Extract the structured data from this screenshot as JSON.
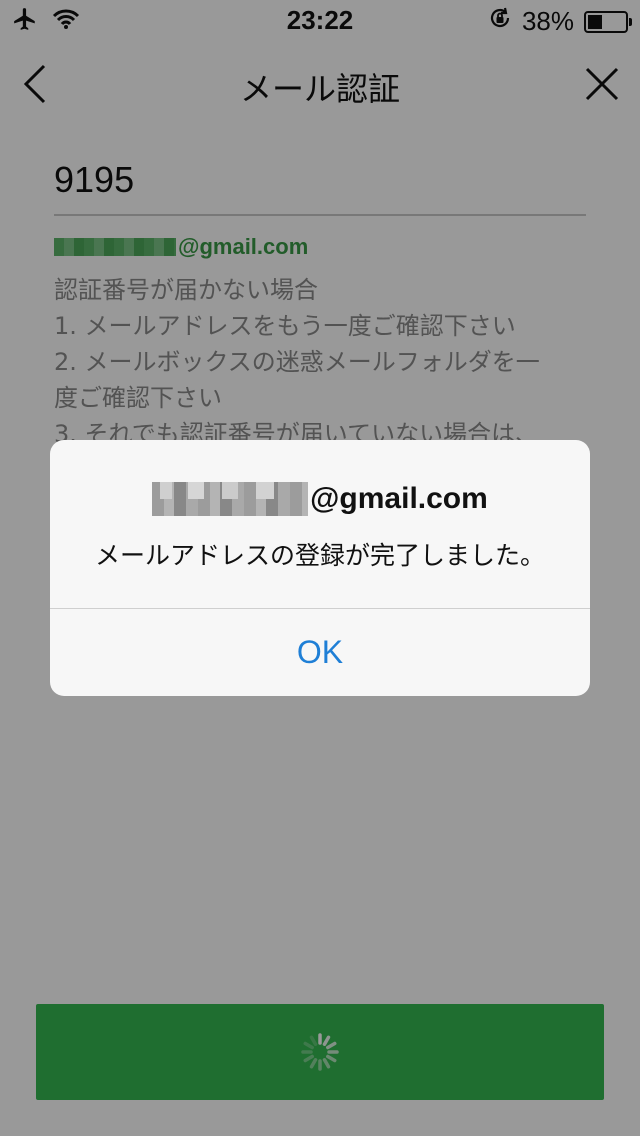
{
  "status_bar": {
    "time": "23:22",
    "battery_percent": "38%",
    "battery_level": 0.38,
    "icons": [
      "airplane-icon",
      "wifi-icon",
      "rotation-lock-icon",
      "battery-icon"
    ]
  },
  "nav": {
    "title": "メール認証",
    "back_icon": "chevron-left-icon",
    "close_icon": "close-icon"
  },
  "form": {
    "code_value": "9195",
    "email_domain": "@gmail.com",
    "help_lines": [
      "認証番号が届かない場合",
      "1. メールアドレスをもう一度ご確認下さい",
      "2. メールボックスの迷惑メールフォルダを一",
      "度ご確認下さい",
      "3. それでも認証番号が届いていない場合は、"
    ]
  },
  "submit": {
    "state": "loading",
    "icon": "spinner-icon"
  },
  "alert": {
    "title_domain": "@gmail.com",
    "message": "メールアドレスの登録が完了しました。",
    "ok_label": "OK"
  },
  "colors": {
    "accent_green": "#35b851",
    "email_green": "#3a9a47",
    "link_blue": "#1f7fd6",
    "overlay": "rgba(0,0,0,0.4)"
  }
}
